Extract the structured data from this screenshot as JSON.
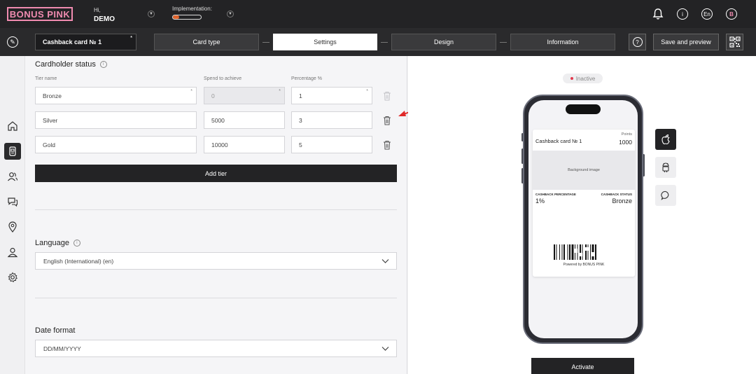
{
  "brand": {
    "logo_text": "BONUS PINK",
    "accent": "#f08bb0"
  },
  "header": {
    "greeting": "Hi,",
    "user_name": "DEMO",
    "implementation_label": "Implementation:",
    "implementation_progress": 0.22,
    "language_badge": "En",
    "avatar_letter": "B",
    "icons": [
      "bell-icon",
      "info-icon",
      "language-icon",
      "avatar"
    ]
  },
  "toolbar": {
    "card_name": "Cashback card № 1",
    "steps": [
      "Card type",
      "Settings",
      "Design",
      "Information"
    ],
    "active_step": "Settings",
    "save_label": "Save and preview"
  },
  "cardholder_status": {
    "title": "Cardholder status",
    "columns": [
      "Tier name",
      "Spend to achieve",
      "Percentage %"
    ],
    "tiers": [
      {
        "name": "Bronze",
        "spend": "0",
        "percent": "1"
      },
      {
        "name": "Silver",
        "spend": "5000",
        "percent": "3"
      },
      {
        "name": "Gold",
        "spend": "10000",
        "percent": "5"
      }
    ],
    "add_tier_label": "Add tier"
  },
  "language": {
    "title": "Language",
    "value": "English (International) (en)"
  },
  "date_format": {
    "title": "Date format",
    "value": "DD/MM/YYYY"
  },
  "preview": {
    "status": "Inactive",
    "card": {
      "name": "Cashback card № 1",
      "points_label": "Points",
      "points_value": "1000",
      "background_label": "Background image",
      "field1_label": "CASHBACK PERCENTAGE",
      "field1_value": "1%",
      "field2_label": "CASHBACK STATUS",
      "field2_value": "Bronze",
      "powered_by": "Powered by BONUS PINK"
    },
    "platforms": [
      "apple-icon",
      "android-icon",
      "chat-icon"
    ],
    "activate_label": "Activate"
  }
}
